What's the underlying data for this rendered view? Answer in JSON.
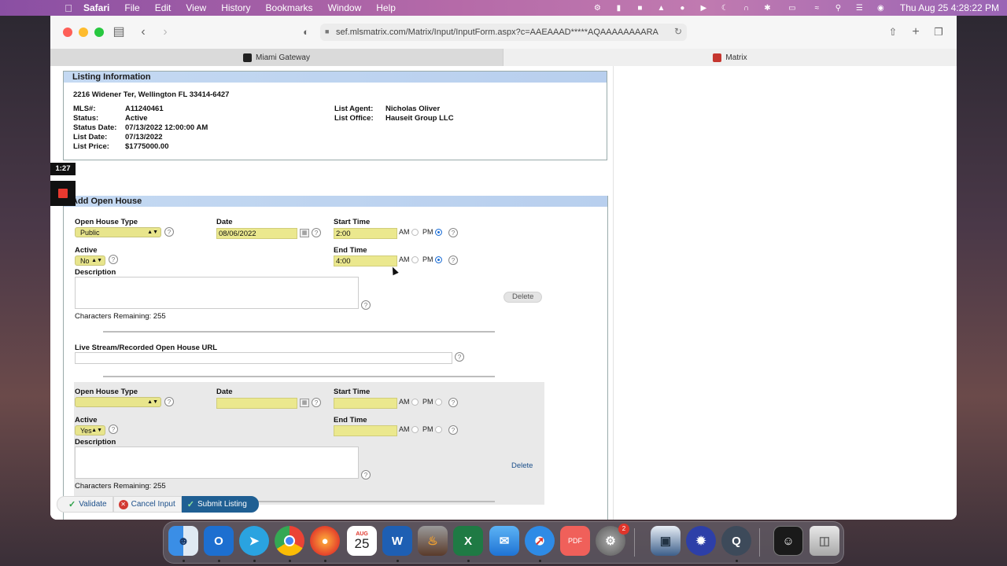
{
  "menubar": {
    "app": "Safari",
    "items": [
      "File",
      "Edit",
      "View",
      "History",
      "Bookmarks",
      "Window",
      "Help"
    ],
    "clock": "Thu Aug 25  4:28:22 PM"
  },
  "browser": {
    "url": "sef.mlsmatrix.com/Matrix/Input/InputForm.aspx?c=AAEAAAD*****AQAAAAAAAARA",
    "tabs": [
      {
        "label": "Miami Gateway"
      },
      {
        "label": "Matrix"
      }
    ]
  },
  "listing": {
    "header": "Listing Information",
    "address": "2216 Widener Ter, Wellington FL 33414-6427",
    "mls_label": "MLS#:",
    "mls": "A11240461",
    "status_label": "Status:",
    "status": "Active",
    "status_date_label": "Status Date:",
    "status_date": "07/13/2022 12:00:00 AM",
    "list_date_label": "List Date:",
    "list_date": "07/13/2022",
    "list_price_label": "List Price:",
    "list_price": "$1775000.00",
    "agent_label": "List Agent:",
    "agent": "Nicholas Oliver",
    "office_label": "List Office:",
    "office": "Hauseit Group LLC"
  },
  "open_house": {
    "header": "Add Open House",
    "labels": {
      "type": "Open House Type",
      "date": "Date",
      "start": "Start Time",
      "end": "End Time",
      "active": "Active",
      "description": "Description",
      "am": "AM",
      "pm": "PM",
      "url": "Live Stream/Recorded Open House URL",
      "delete": "Delete"
    },
    "entry1": {
      "type": "Public",
      "date": "08/06/2022",
      "start": "2:00",
      "end": "4:00",
      "active": "No",
      "start_period": "PM",
      "end_period": "PM",
      "chars_remaining": "Characters Remaining: 255"
    },
    "entry2": {
      "type": "",
      "date": "",
      "start": "",
      "end": "",
      "active": "Yes",
      "chars_remaining": "Characters Remaining: 255"
    }
  },
  "actions": {
    "validate": "Validate",
    "cancel": "Cancel Input",
    "submit": "Submit Listing"
  },
  "recorder": {
    "timer": "1:27"
  },
  "dock": {
    "calendar_month": "AUG",
    "calendar_day": "25",
    "settings_badge": "2",
    "pdf_label": "PDF"
  }
}
